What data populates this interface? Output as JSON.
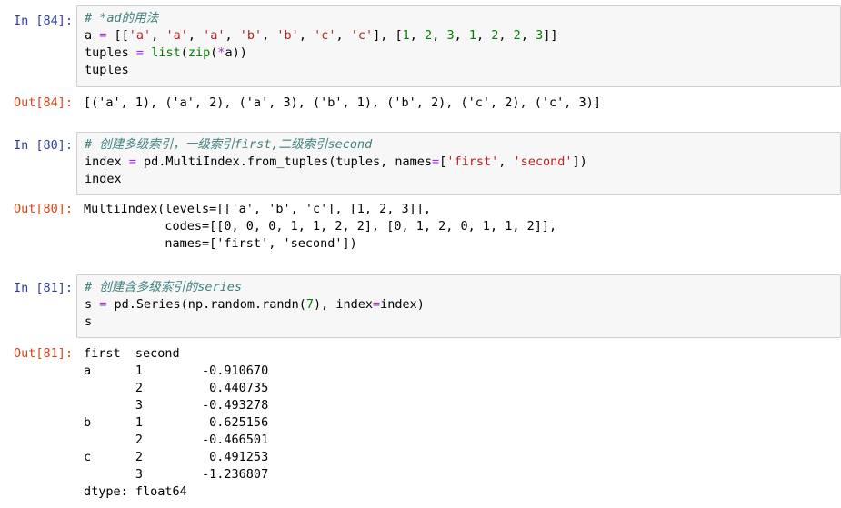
{
  "cells": [
    {
      "in_prompt": "In  [84]:",
      "out_prompt": "Out[84]:",
      "code": {
        "l1_comment": "# *ad的用法",
        "l2": {
          "a": "a ",
          "eq": "=",
          "rest_open": " [[",
          "s1": "'a'",
          "c1": ", ",
          "s2": "'a'",
          "c2": ", ",
          "s3": "'a'",
          "c3": ", ",
          "s4": "'b'",
          "c4": ", ",
          "s5": "'b'",
          "c5": ", ",
          "s6": "'c'",
          "c6": ", ",
          "s7": "'c'",
          "mid": "], [",
          "n1": "1",
          "d1": ", ",
          "n2": "2",
          "d2": ", ",
          "n3": "3",
          "d3": ", ",
          "n4": "1",
          "d4": ", ",
          "n5": "2",
          "d5": ", ",
          "n6": "2",
          "d6": ", ",
          "n7": "3",
          "end": "]]"
        },
        "l3": {
          "lhs": "tuples ",
          "eq": "=",
          "sp": " ",
          "fn": "list",
          "p1": "(",
          "fn2": "zip",
          "p2": "(",
          "star": "*",
          "arg": "a))"
        },
        "l4": "tuples"
      },
      "output": [
        "[('a', 1), ('a', 2), ('a', 3), ('b', 1), ('b', 2), ('c', 2), ('c', 3)]"
      ]
    },
    {
      "in_prompt": "In  [80]:",
      "out_prompt": "Out[80]:",
      "code": {
        "l1_comment": "# 创建多级索引，一级索引first,二级索引second",
        "l2": {
          "lhs": "index ",
          "eq": "=",
          "mid": " pd.MultiIndex.from_tuples(tuples, names",
          "eq2": "=",
          "open": "[",
          "s1": "'first'",
          "comma": ", ",
          "s2": "'second'",
          "close": "])"
        },
        "l3": "index"
      },
      "output": [
        "MultiIndex(levels=[['a', 'b', 'c'], [1, 2, 3]],",
        "           codes=[[0, 0, 0, 1, 1, 2, 2], [0, 1, 2, 0, 1, 1, 2]],",
        "           names=['first', 'second'])"
      ]
    },
    {
      "in_prompt": "In  [81]:",
      "out_prompt": "Out[81]:",
      "code": {
        "l1_comment": "# 创建含多级索引的series",
        "l2": {
          "lhs": "s ",
          "eq": "=",
          "mid": " pd.Series(np.random.randn(",
          "n": "7",
          "mid2": "), index",
          "eq2": "=",
          "end": "index)"
        },
        "l3": "s"
      },
      "output": [
        "first  second",
        "a      1        -0.910670",
        "       2         0.440735",
        "       3        -0.493278",
        "b      1         0.625156",
        "       2        -0.466501",
        "c      2         0.491253",
        "       3        -1.236807",
        "dtype: float64"
      ]
    }
  ]
}
